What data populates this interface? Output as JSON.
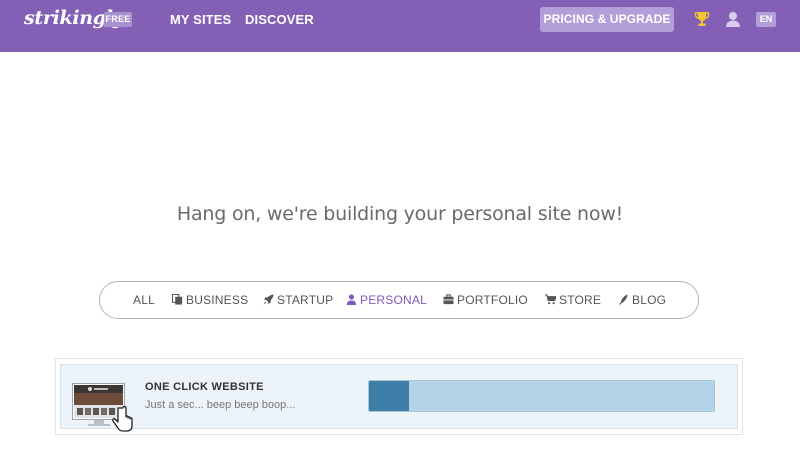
{
  "topbar": {
    "logo": "strikingly",
    "plan_badge": "FREE",
    "nav": {
      "my_sites": "MY SITES",
      "discover": "DISCOVER"
    },
    "pricing_button": "PRICING & UPGRADE",
    "icons": {
      "trophy": "trophy-icon",
      "user": "user-icon"
    },
    "language": "EN",
    "colors": {
      "bar": "#8360b5",
      "button": "#b29ed8",
      "trophy": "#f2c531"
    }
  },
  "heading": "Hang on, we're building your personal site now!",
  "categories": {
    "all": "ALL",
    "business": "BUSINESS",
    "startup": "STARTUP",
    "personal": "PERSONAL",
    "portfolio": "PORTFOLIO",
    "store": "STORE",
    "blog": "BLOG",
    "selected": "PERSONAL",
    "accent_color": "#7c5cba"
  },
  "progress_card": {
    "title": "ONE CLICK WEBSITE",
    "subtitle": "Just a sec... beep beep boop...",
    "progress_fraction": 0.115,
    "colors": {
      "fill": "#3e7faa",
      "track": "#b3d4e8"
    }
  }
}
